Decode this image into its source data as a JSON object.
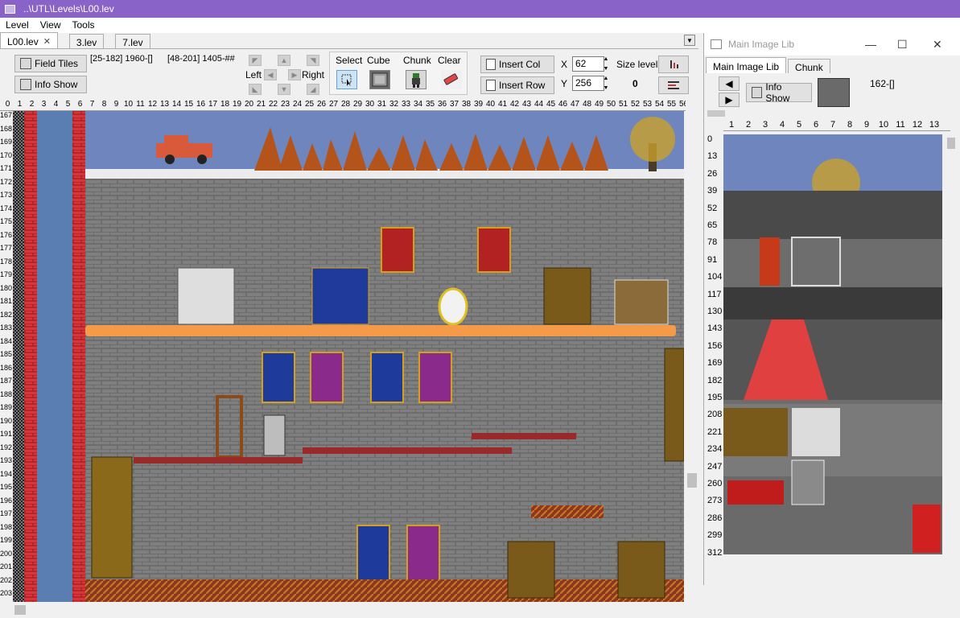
{
  "window": {
    "title": "..\\UTL\\Levels\\L00.lev"
  },
  "menu": [
    "Level",
    "View",
    "Tools"
  ],
  "tabs": [
    {
      "label": "L00.lev",
      "close": "✕"
    },
    {
      "label": "3.lev"
    },
    {
      "label": "7.lev"
    }
  ],
  "toolbar": {
    "field_tiles": "Field Tiles",
    "info_show": "Info Show",
    "coord1": "[25-182] 1960-[]",
    "coord2": "[48-201] 1405-##",
    "left": "Left",
    "right": "Right",
    "tools": [
      "Select",
      "Cube",
      "Chunk",
      "Clear"
    ],
    "insert_col": "Insert Col",
    "insert_row": "Insert Row",
    "x_label": "X",
    "x_value": "62",
    "y_label": "Y",
    "y_value": "256",
    "size_level": "Size level",
    "size_value": "0"
  },
  "ruler_top": [
    "0",
    "1",
    "2",
    "3",
    "4",
    "5",
    "6",
    "7",
    "8",
    "9",
    "10",
    "11",
    "12",
    "13",
    "14",
    "15",
    "16",
    "17",
    "18",
    "19",
    "20",
    "21",
    "22",
    "23",
    "24",
    "25",
    "26",
    "27",
    "28",
    "29",
    "30",
    "31",
    "32",
    "33",
    "34",
    "35",
    "36",
    "37",
    "38",
    "39",
    "40",
    "41",
    "42",
    "43",
    "44",
    "45",
    "46",
    "47",
    "48",
    "49",
    "50",
    "51",
    "52",
    "53",
    "54",
    "55",
    "56"
  ],
  "ruler_left": [
    "167",
    "168",
    "169",
    "170",
    "171",
    "172",
    "173",
    "174",
    "175",
    "176",
    "177",
    "178",
    "179",
    "180",
    "181",
    "182",
    "183",
    "184",
    "185",
    "186",
    "187",
    "188",
    "189",
    "190",
    "191",
    "192",
    "193",
    "194",
    "195",
    "196",
    "197",
    "198",
    "199",
    "200",
    "201",
    "202",
    "203"
  ],
  "lib": {
    "title": "Main Image Lib",
    "tabs": [
      "Main Image Lib",
      "Chunk"
    ],
    "info_show": "Info Show",
    "tile_id": "162-[]",
    "ruler_top": [
      "1",
      "2",
      "3",
      "4",
      "5",
      "6",
      "7",
      "8",
      "9",
      "10",
      "11",
      "12",
      "13"
    ],
    "ruler_left": [
      "0",
      "13",
      "26",
      "39",
      "52",
      "65",
      "78",
      "91",
      "104",
      "117",
      "130",
      "143",
      "156",
      "169",
      "182",
      "195",
      "208",
      "221",
      "234",
      "247",
      "260",
      "273",
      "286",
      "299",
      "312"
    ]
  }
}
